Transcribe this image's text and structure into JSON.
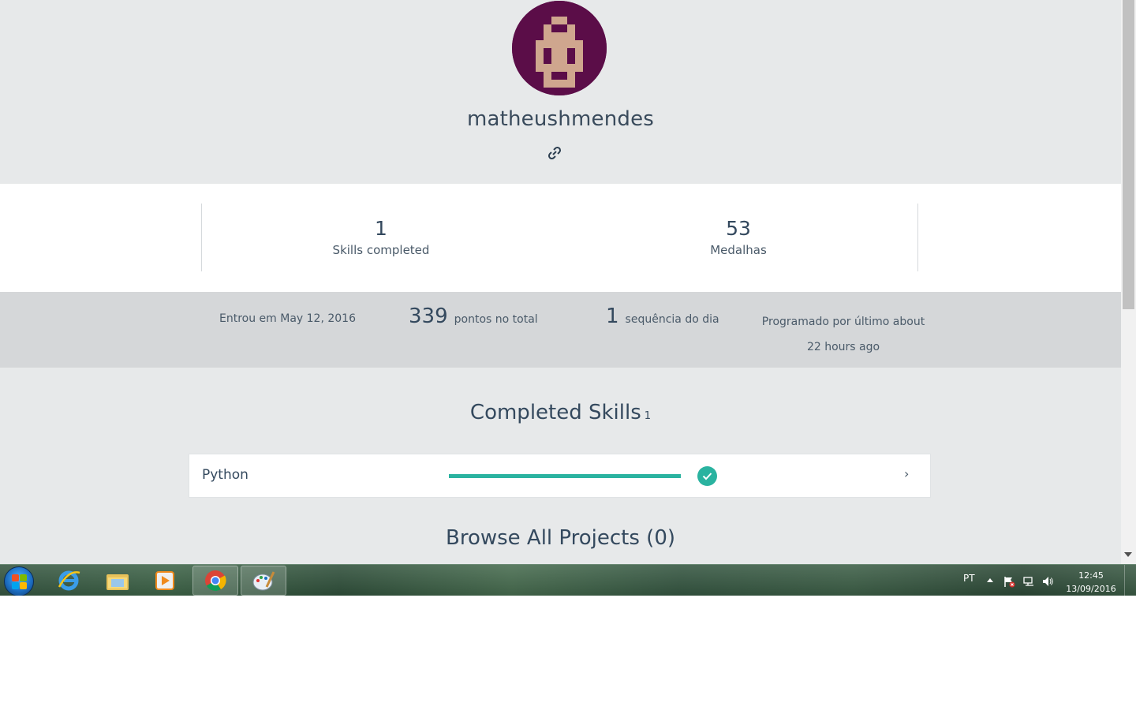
{
  "profile": {
    "username": "matheushmendes",
    "avatar_colors": {
      "background": "#5b0d48",
      "face": "#cfa68e"
    }
  },
  "stats": [
    {
      "value": "1",
      "label": "Skills completed"
    },
    {
      "value": "53",
      "label": "Medalhas"
    }
  ],
  "info": {
    "joined": "Entrou em May 12, 2016",
    "points_value": "339",
    "points_label": "pontos no total",
    "streak_value": "1",
    "streak_label": "sequência do dia",
    "last_coded": "Programado por último about 22 hours ago"
  },
  "completed_skills": {
    "title": "Completed Skills",
    "count": "1",
    "items": [
      {
        "name": "Python",
        "progress": 1.0,
        "complete": true
      }
    ]
  },
  "projects": {
    "title": "Browse All Projects (0)"
  },
  "taskbar": {
    "apps": [
      {
        "name": "internet-explorer",
        "icon": "ie-icon",
        "active": false
      },
      {
        "name": "windows-explorer",
        "icon": "folder-icon",
        "active": false
      },
      {
        "name": "media-player",
        "icon": "media-player-icon",
        "active": false
      },
      {
        "name": "chrome",
        "icon": "chrome-icon",
        "active": true
      },
      {
        "name": "paint",
        "icon": "paint-icon",
        "active": true
      }
    ],
    "language": "PT",
    "time": "12:45",
    "date": "13/09/2016"
  },
  "colors": {
    "accent": "#2ab3a0",
    "text": "#34495e",
    "page_bg": "#e7e9ea",
    "info_band_bg": "#d5d7d9"
  }
}
